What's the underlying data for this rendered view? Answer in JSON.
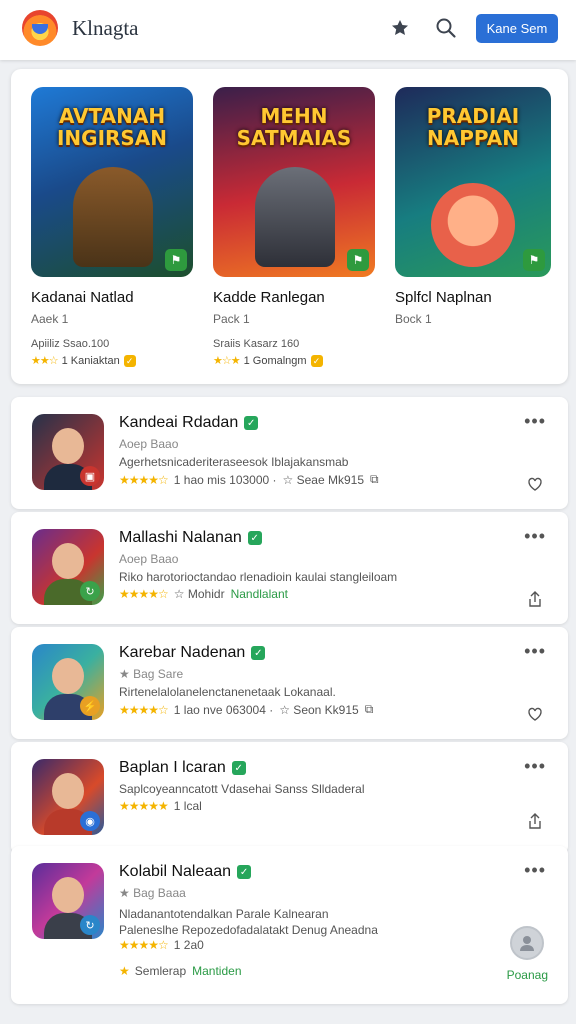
{
  "header": {
    "app_title": "Klnagta",
    "logo_icon": "game-controller-logo",
    "star_icon": "star-icon",
    "search_icon": "search-icon",
    "signin_label": "Kane Sem",
    "accent": "#2a6fd6"
  },
  "featured": [
    {
      "headline": "AVTANAH INGIRSAN",
      "title": "Kadanai Natlad",
      "sub": "Aaek  1",
      "price": "Apiiliz Ssao.100",
      "stars": "★★☆",
      "rating": "1 Kaniaktan",
      "colors": [
        "#1f7ad6",
        "#1c4f2c"
      ]
    },
    {
      "headline": "MEHN SATMAIAS",
      "title": "Kadde Ranlegan",
      "sub": "Pack  1",
      "price": "Sraiis Kasarz 160",
      "stars": "★☆★",
      "rating": "1 Gomalngm",
      "colors": [
        "#c92a35",
        "#3a1f4a"
      ]
    },
    {
      "headline": "PRADIAI NAPPAN",
      "title": "Splfcl Naplnan",
      "sub": "Bock  1",
      "price": "",
      "stars": "",
      "rating": "",
      "colors": [
        "#177d80",
        "#1e2a5a"
      ]
    }
  ],
  "rows": [
    {
      "title": "Kandeai Rdadan",
      "line1": "Aoep  Baao",
      "line2": "Agerhetsnicaderiteraseesok Iblajakansmab",
      "stars": "★★★★☆",
      "meta": "1 hao mis  103000 ·",
      "meta2": "☆ Seae Mk915",
      "action_icon": "heart-icon",
      "colors": [
        "#26324a",
        "#c9352f"
      ]
    },
    {
      "title": "Mallashi Nalanan",
      "line1": "Aoep  Baao",
      "line2": "Riko harotorioctandao rlenadioin kaulai stangleiloam",
      "stars": "★★★★☆",
      "meta": "☆ Mohidr",
      "meta2": "Nandlalant",
      "action_icon": "share-icon",
      "colors": [
        "#6a2d8c",
        "#3aa24a"
      ]
    },
    {
      "title": "Karebar Nadenan",
      "line1": "★ Bag  Sare",
      "line2": "Rirtenelalolanelenctanenetaak Lokanaal.",
      "stars": "★★★★☆",
      "meta": "1 lao nve  063004 ·",
      "meta2": "☆ Seon Kk915",
      "action_icon": "heart-icon",
      "colors": [
        "#2a86c9",
        "#e8a023"
      ]
    },
    {
      "title": "Baplan I lcaran",
      "line1": "Saplcoyeanncatott Vdasehai Sanss Slldaderal",
      "line2": "",
      "stars": "★★★★★",
      "meta": "1 lcal",
      "meta2": "",
      "action_icon": "share-icon",
      "colors": [
        "#3a2a6a",
        "#d84a2a"
      ]
    },
    {
      "title": "Kolabil Naleaan",
      "line1": "★ Bag  Baaa",
      "line2": "Nladanantotendalkan Parale Kalnearan",
      "line3": "Paleneslhe  Repozedofadalatakt  Denug Aneadna",
      "stars": "★★★★☆",
      "meta": "1 2a0",
      "meta2": "",
      "footer_left": "Semlerap",
      "footer_green": "Mantiden",
      "profile_label": "Poanag",
      "colors": [
        "#5a2d9a",
        "#2a86c9"
      ]
    }
  ]
}
